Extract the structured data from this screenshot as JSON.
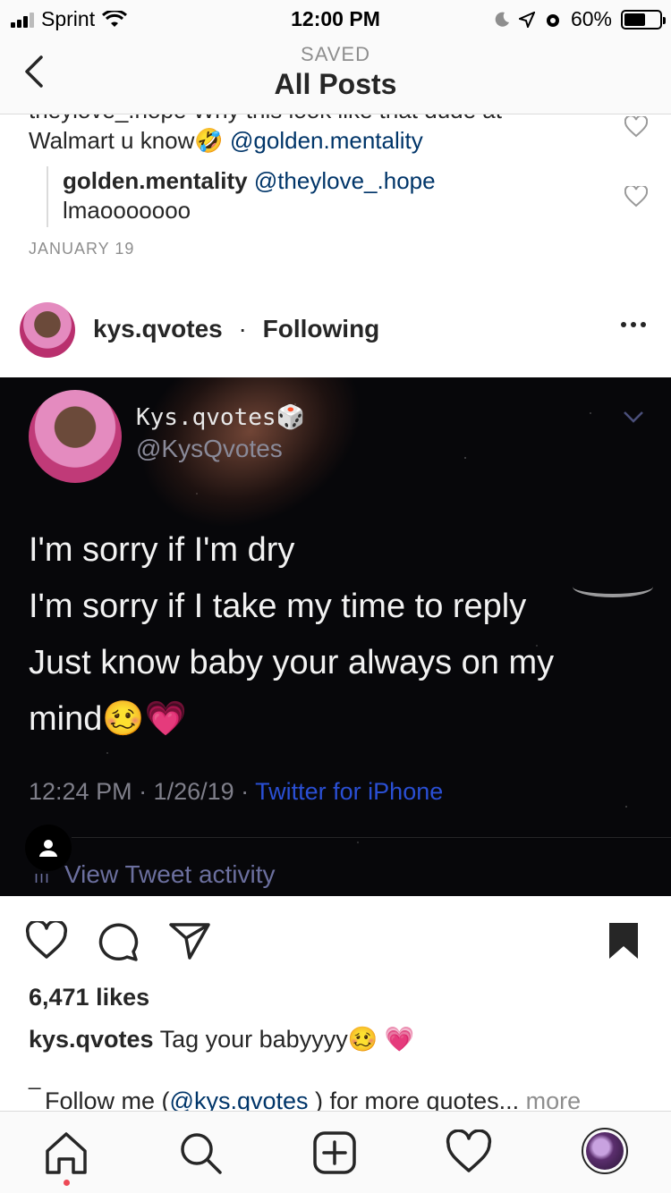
{
  "status_bar": {
    "carrier": "Sprint",
    "time": "12:00 PM",
    "battery": "60%",
    "battery_level": 0.6
  },
  "header": {
    "subtitle": "SAVED",
    "title": "All Posts"
  },
  "comments": {
    "cut_line": "theylove_.hope Why this look like that dude at",
    "first_text": "Walmart u know🤣",
    "first_mention": "@golden.mentality",
    "reply_user": "golden.mentality",
    "reply_mention": "@theylove_.hope",
    "reply_text": "lmaooooooo",
    "date": "JANUARY 19"
  },
  "post": {
    "username": "kys.qvotes",
    "separator": "·",
    "follow_status": "Following"
  },
  "tweet": {
    "display_name": "Kys.qvotes🎲",
    "handle": "@KysQvotes",
    "lines": [
      "I'm sorry if I'm dry",
      "I'm sorry if I take my time to reply",
      "Just know baby your always on my",
      "mind🥴💗"
    ],
    "timestamp": "12:24 PM · 1/26/19 · ",
    "source": "Twitter for iPhone",
    "activity": "View Tweet activity",
    "activity_bars": "ııı"
  },
  "engagement": {
    "likes": "6,471 likes",
    "caption_user": "kys.qvotes",
    "caption_text": " Tag your babyyyy🥴 💗",
    "dash": "_",
    "follow_prefix": "Follow me (",
    "follow_mention": "@kys.qvotes",
    "follow_suffix": " ) for more quotes... ",
    "more": "more"
  },
  "colors": {
    "mention": "#003569",
    "tweet_link": "#2a4fd4",
    "notification": "#ed4956"
  }
}
